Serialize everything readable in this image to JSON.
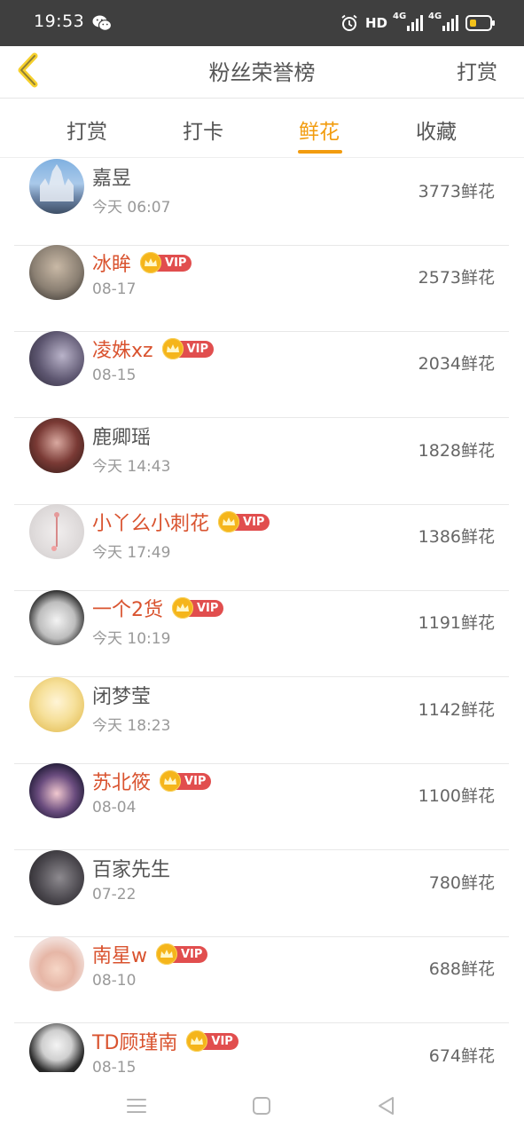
{
  "status_bar": {
    "time": "19:53",
    "hd": "HD",
    "net1": "4G",
    "net2": "4G"
  },
  "header": {
    "title": "粉丝荣誉榜",
    "action": "打赏"
  },
  "tabs": [
    {
      "label": "打赏",
      "active": false
    },
    {
      "label": "打卡",
      "active": false
    },
    {
      "label": "鲜花",
      "active": true
    },
    {
      "label": "收藏",
      "active": false
    }
  ],
  "vip_label": "VIP",
  "list": [
    {
      "name": "嘉昱",
      "date": "今天 06:07",
      "count": "3773鲜花",
      "vip": false
    },
    {
      "name": "冰眸",
      "date": "08-17",
      "count": "2573鲜花",
      "vip": true
    },
    {
      "name": "凌姝xz",
      "date": "08-15",
      "count": "2034鲜花",
      "vip": true
    },
    {
      "name": "鹿卿瑶",
      "date": "今天 14:43",
      "count": "1828鲜花",
      "vip": false
    },
    {
      "name": "小丫么小刺花",
      "date": "今天 17:49",
      "count": "1386鲜花",
      "vip": true
    },
    {
      "name": "一个2货",
      "date": "今天 10:19",
      "count": "1191鲜花",
      "vip": true
    },
    {
      "name": "闭梦莹",
      "date": "今天 18:23",
      "count": "1142鲜花",
      "vip": false
    },
    {
      "name": "苏北筱",
      "date": "08-04",
      "count": "1100鲜花",
      "vip": true
    },
    {
      "name": "百家先生",
      "date": "07-22",
      "count": "780鲜花",
      "vip": false
    },
    {
      "name": "南星w",
      "date": "08-10",
      "count": "688鲜花",
      "vip": true
    },
    {
      "name": "TD顾瑾南",
      "date": "08-15",
      "count": "674鲜花",
      "vip": true
    }
  ],
  "colors": {
    "accent": "#f29c0f",
    "vip_name": "#d9532f",
    "vip_badge": "#e14e4e",
    "crown": "#f5b51b"
  }
}
